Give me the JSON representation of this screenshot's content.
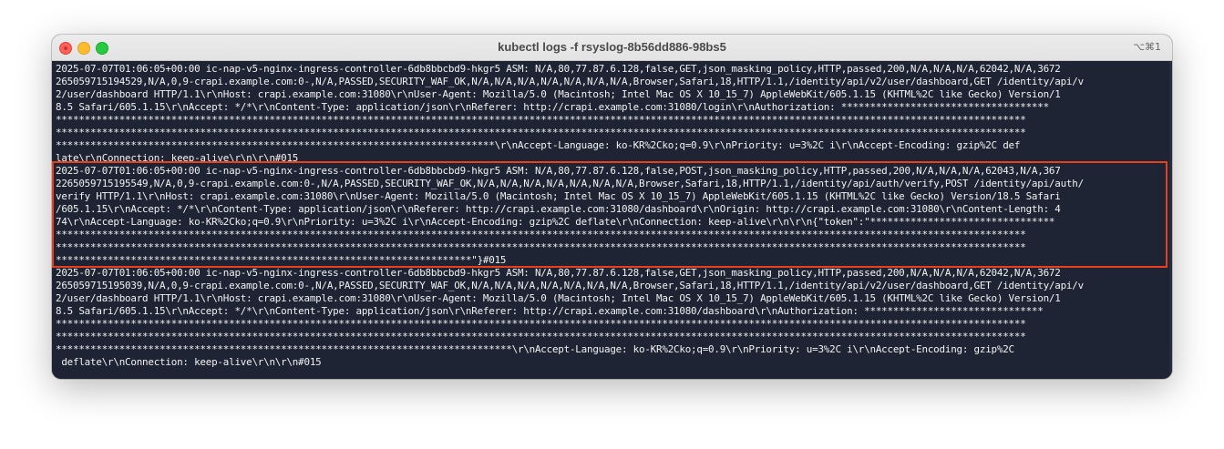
{
  "window": {
    "title": "kubectl logs -f rsyslog-8b56dd886-98bs5",
    "shortcut": "⌥⌘1"
  },
  "terminal": {
    "lines": [
      "2025-07-07T01:06:05+00:00 ic-nap-v5-nginx-ingress-controller-6db8bbcbd9-hkgr5 ASM: N/A,80,77.87.6.128,false,GET,json_masking_policy,HTTP,passed,200,N/A,N/A,N/A,62042,N/A,3672",
      "265059715194529,N/A,0,9-crapi.example.com:0-,N/A,PASSED,SECURITY_WAF_OK,N/A,N/A,N/A,N/A,N/A,N/A,N/A,Browser,Safari,18,HTTP/1.1,/identity/api/v2/user/dashboard,GET /identity/api/v",
      "2/user/dashboard HTTP/1.1\\r\\nHost: crapi.example.com:31080\\r\\nUser-Agent: Mozilla/5.0 (Macintosh; Intel Mac OS X 10_15_7) AppleWebKit/605.1.15 (KHTML%2C like Gecko) Version/1",
      "8.5 Safari/605.1.15\\r\\nAccept: */*\\r\\nContent-Type: application/json\\r\\nReferer: http://crapi.example.com:31080/login\\r\\nAuthorization: ************************************",
      "************************************************************************************************************************************************************************",
      "************************************************************************************************************************************************************************",
      "****************************************************************************\\r\\nAccept-Language: ko-KR%2Cko;q=0.9\\r\\nPriority: u=3%2C i\\r\\nAccept-Encoding: gzip%2C def",
      "late\\r\\nConnection: keep-alive\\r\\n\\r\\n#015",
      "2025-07-07T01:06:05+00:00 ic-nap-v5-nginx-ingress-controller-6db8bbcbd9-hkgr5 ASM: N/A,80,77.87.6.128,false,POST,json_masking_policy,HTTP,passed,200,N/A,N/A,N/A,62043,N/A,367",
      "2265059715195549,N/A,0,9-crapi.example.com:0-,N/A,PASSED,SECURITY_WAF_OK,N/A,N/A,N/A,N/A,N/A,N/A,N/A,Browser,Safari,18,HTTP/1.1,/identity/api/auth/verify,POST /identity/api/auth/",
      "verify HTTP/1.1\\r\\nHost: crapi.example.com:31080\\r\\nUser-Agent: Mozilla/5.0 (Macintosh; Intel Mac OS X 10_15_7) AppleWebKit/605.1.15 (KHTML%2C like Gecko) Version/18.5 Safari",
      "/605.1.15\\r\\nAccept: */*\\r\\nContent-Type: application/json\\r\\nReferer: http://crapi.example.com:31080/dashboard\\r\\nOrigin: http://crapi.example.com:31080\\r\\nContent-Length: 4",
      "74\\r\\nAccept-Language: ko-KR%2Cko;q=0.9\\r\\nPriority: u=3%2C i\\r\\nAccept-Encoding: gzip%2C deflate\\r\\nConnection: keep-alive\\r\\n\\r\\n{\"token\":\"********************************",
      "************************************************************************************************************************************************************************",
      "************************************************************************************************************************************************************************",
      "************************************************************************\"}#015",
      "2025-07-07T01:06:05+00:00 ic-nap-v5-nginx-ingress-controller-6db8bbcbd9-hkgr5 ASM: N/A,80,77.87.6.128,false,GET,json_masking_policy,HTTP,passed,200,N/A,N/A,N/A,62042,N/A,3672",
      "265059715195039,N/A,0,9-crapi.example.com:0-,N/A,PASSED,SECURITY_WAF_OK,N/A,N/A,N/A,N/A,N/A,N/A,N/A,Browser,Safari,18,HTTP/1.1,/identity/api/v2/user/dashboard,GET /identity/api/v",
      "2/user/dashboard HTTP/1.1\\r\\nHost: crapi.example.com:31080\\r\\nUser-Agent: Mozilla/5.0 (Macintosh; Intel Mac OS X 10_15_7) AppleWebKit/605.1.15 (KHTML%2C like Gecko) Version/1",
      "8.5 Safari/605.1.15\\r\\nAccept: */*\\r\\nContent-Type: application/json\\r\\nReferer: http://crapi.example.com:31080/dashboard\\r\\nAuthorization: *******************************",
      "************************************************************************************************************************************************************************",
      "************************************************************************************************************************************************************************",
      "*******************************************************************************\\r\\nAccept-Language: ko-KR%2Cko;q=0.9\\r\\nPriority: u=3%2C i\\r\\nAccept-Encoding: gzip%2C",
      " deflate\\r\\nConnection: keep-alive\\r\\n\\r\\n#015"
    ]
  },
  "colors": {
    "terminal_bg": "#1e2433",
    "terminal_fg": "#f2f2f2",
    "highlight_border": "#e8401c"
  }
}
